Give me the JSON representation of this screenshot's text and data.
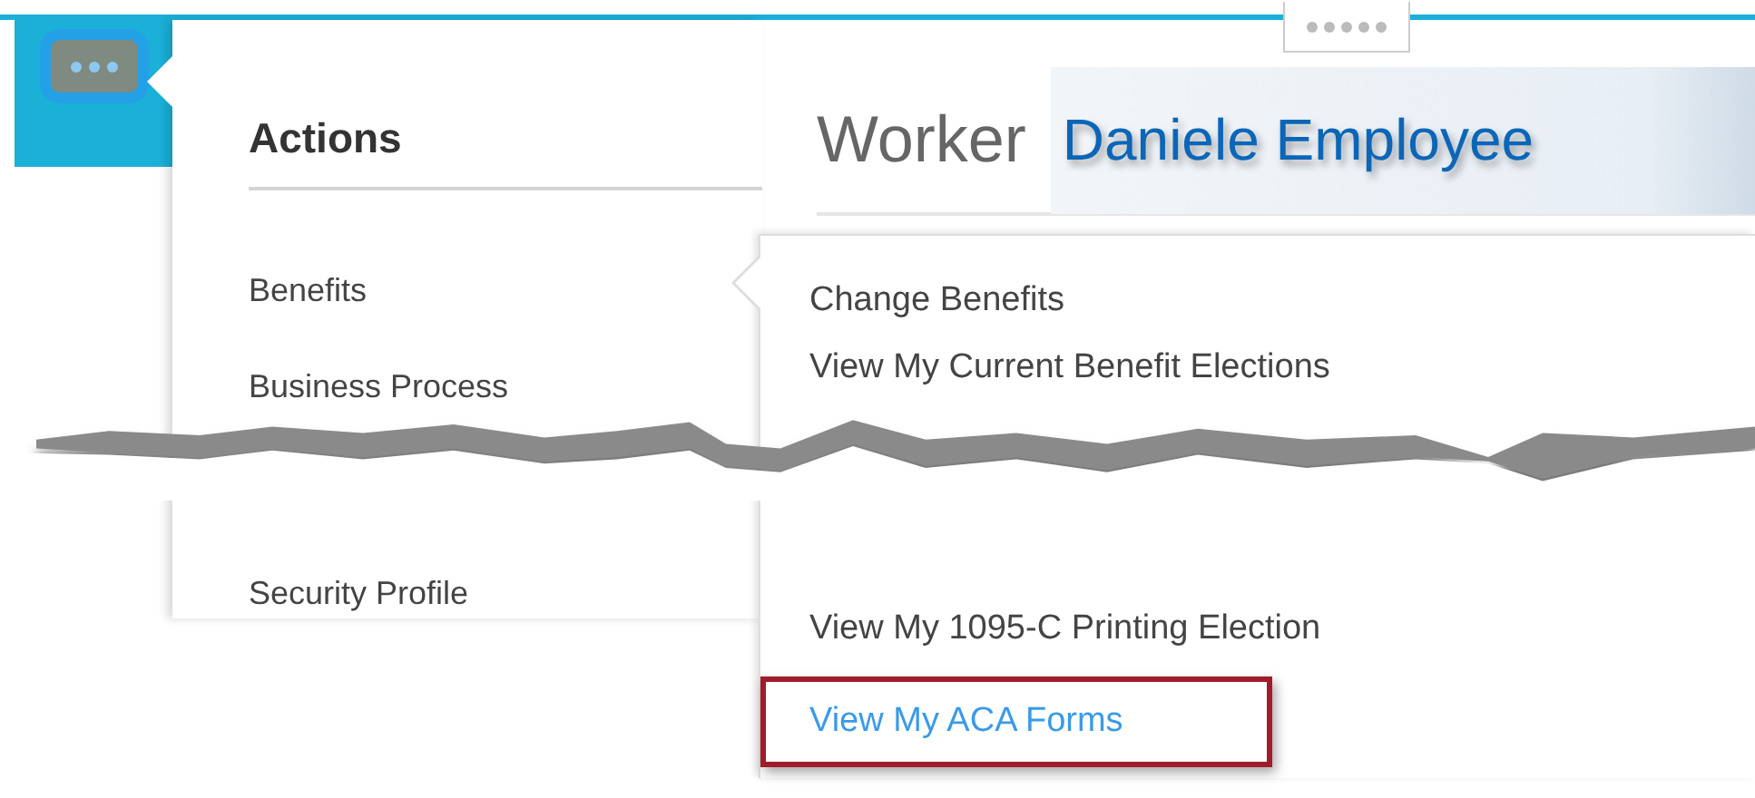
{
  "actions_menu": {
    "title": "Actions",
    "upper_items": [
      "Benefits",
      "Business Process"
    ],
    "lower_items": [
      "Security Profile"
    ]
  },
  "worker": {
    "label": "Worker",
    "name": "Daniele Employee"
  },
  "benefits_submenu": {
    "upper_items": [
      {
        "label": "Change Benefits",
        "highlighted": false
      },
      {
        "label": "View My Current Benefit Elections",
        "highlighted": false
      }
    ],
    "lower_items": [
      {
        "label": "View My 1095-C Printing Election",
        "highlighted": false
      },
      {
        "label": "View My ACA Forms",
        "highlighted": true
      }
    ]
  }
}
